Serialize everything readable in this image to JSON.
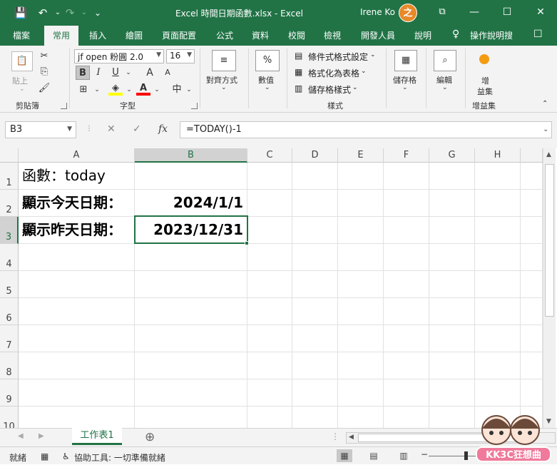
{
  "window": {
    "title": "Excel 時間日期函數.xlsx - Excel",
    "user": "Irene Ko",
    "avatar_initial": "之"
  },
  "quick_access": {
    "save": "💾",
    "undo": "↶",
    "redo": "↷",
    "customize": "⌄"
  },
  "window_controls": {
    "ribbon_display": "⧉",
    "minimize": "—",
    "maximize": "☐",
    "close": "✕"
  },
  "tabs": [
    "檔案",
    "常用",
    "插入",
    "繪圖",
    "頁面配置",
    "公式",
    "資料",
    "校閱",
    "檢視",
    "開發人員",
    "說明"
  ],
  "tab_active": "常用",
  "tell_me": "操作說明搜",
  "share_icon": "💬",
  "ribbon": {
    "clipboard": {
      "paste": "貼上",
      "label": "剪貼簿"
    },
    "font": {
      "font_name": "jf open 粉圓 2.0",
      "font_size": "16",
      "bold": "B",
      "italic": "I",
      "underline": "U",
      "grow": "A",
      "shrink": "A",
      "phonetic": "中",
      "label": "字型"
    },
    "alignment": {
      "label": "對齊方式"
    },
    "number": {
      "label": "數值",
      "icon": "%"
    },
    "styles": {
      "conditional": "條件式格式設定",
      "as_table": "格式化為表格",
      "cell_styles": "儲存格樣式",
      "label": "樣式"
    },
    "cells": {
      "label": "儲存格"
    },
    "editing": {
      "label": "編輯"
    },
    "addins": {
      "button_line1": "增",
      "button_line2": "益集",
      "label": "增益集"
    }
  },
  "formula_bar": {
    "name_box": "B3",
    "cancel": "✕",
    "enter": "✓",
    "fx": "fx",
    "formula": "=TODAY()-1"
  },
  "columns": [
    "A",
    "B",
    "C",
    "D",
    "E",
    "F",
    "G",
    "H"
  ],
  "selected_column": "B",
  "rows": [
    "1",
    "2",
    "3",
    "4",
    "5",
    "6",
    "7",
    "8",
    "9",
    "10"
  ],
  "selected_row": "3",
  "cells": {
    "A1": "函數：today",
    "A2": "顯示今天日期：",
    "B2": "2024/1/1",
    "A3": "顯示昨天日期：",
    "B3": "2023/12/31"
  },
  "sheet_tabs": [
    "工作表1"
  ],
  "add_sheet": "⊕",
  "status": {
    "ready": "就緒",
    "accessibility": "協助工具: 一切準備就緒"
  },
  "watermark": "KK3C狂想曲"
}
